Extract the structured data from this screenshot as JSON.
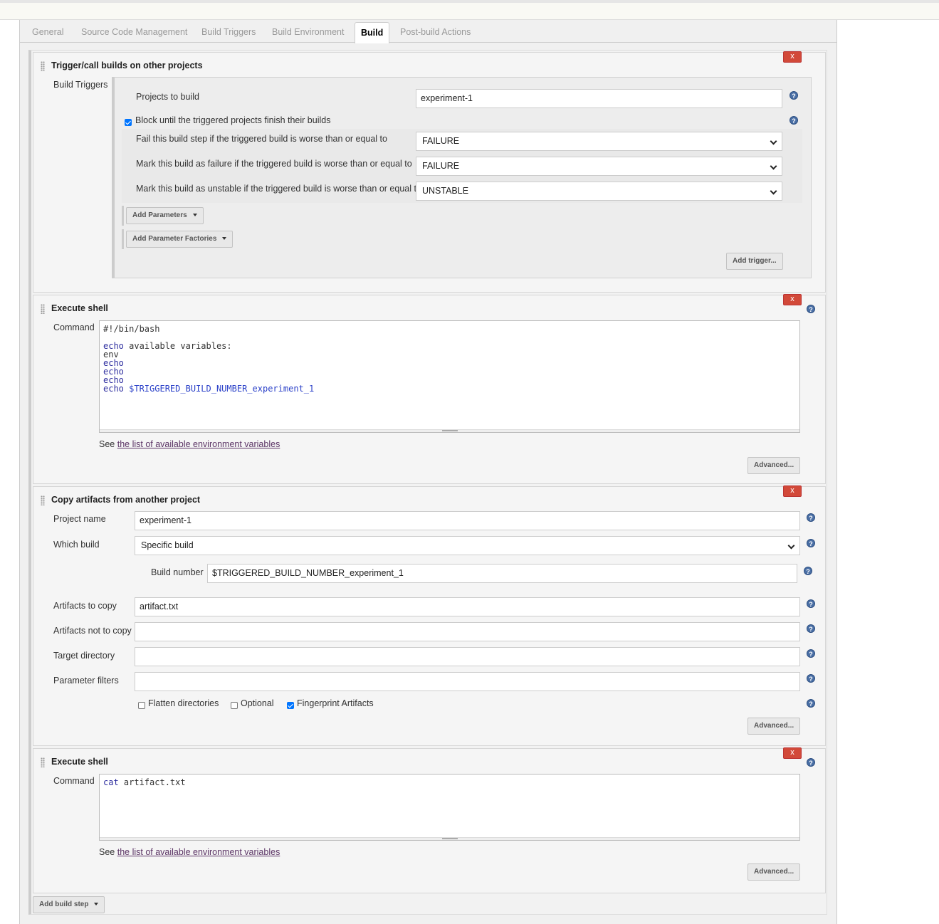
{
  "tabs": [
    {
      "label": "General"
    },
    {
      "label": "Source Code Management"
    },
    {
      "label": "Build Triggers"
    },
    {
      "label": "Build Environment"
    },
    {
      "label": "Build"
    },
    {
      "label": "Post-build Actions"
    }
  ],
  "trigger_block": {
    "title": "Trigger/call builds on other projects",
    "delete_label": "x",
    "build_triggers_label": "Build Triggers",
    "projects_label": "Projects to build",
    "projects_value": "experiment-1",
    "block_label": "Block until the triggered projects finish their builds",
    "block_checked": true,
    "fail_step_label": "Fail this build step if the triggered build is worse than or equal to",
    "fail_step_value": "FAILURE",
    "mark_failure_label": "Mark this build as failure if the triggered build is worse than or equal to",
    "mark_failure_value": "FAILURE",
    "mark_unstable_label": "Mark this build as unstable if the triggered build is worse than or equal to",
    "mark_unstable_value": "UNSTABLE",
    "add_parameters": "Add Parameters",
    "add_parameter_factories": "Add Parameter Factories",
    "add_trigger": "Add trigger..."
  },
  "shell1": {
    "title": "Execute shell",
    "delete_label": "x",
    "command_label": "Command",
    "lines": {
      "l1": "#!/bin/bash",
      "l3_kw": "echo",
      "l3_rest": " available variables:",
      "l4": "env",
      "l5": "echo",
      "l6": "echo",
      "l7": "echo",
      "l8_kw": "echo",
      "l8_var": " $TRIGGERED_BUILD_NUMBER_experiment_1"
    },
    "see_prefix": "See ",
    "see_link": "the list of available environment variables",
    "advanced": "Advanced..."
  },
  "copy_block": {
    "title": "Copy artifacts from another project",
    "delete_label": "x",
    "project_name_label": "Project name",
    "project_name_value": "experiment-1",
    "which_build_label": "Which build",
    "which_build_value": "Specific build",
    "build_number_label": "Build number",
    "build_number_value": "$TRIGGERED_BUILD_NUMBER_experiment_1",
    "artifacts_label": "Artifacts to copy",
    "artifacts_value": "artifact.txt",
    "not_copy_label": "Artifacts not to copy",
    "not_copy_value": "",
    "target_dir_label": "Target directory",
    "target_dir_value": "",
    "param_filters_label": "Parameter filters",
    "param_filters_value": "",
    "flatten_label": "Flatten directories",
    "flatten_checked": false,
    "optional_label": "Optional",
    "optional_checked": false,
    "fingerprint_label": "Fingerprint Artifacts",
    "fingerprint_checked": true,
    "advanced": "Advanced..."
  },
  "shell2": {
    "title": "Execute shell",
    "delete_label": "x",
    "command_label": "Command",
    "line_kw": "cat",
    "line_rest": " artifact.txt",
    "see_prefix": "See ",
    "see_link": "the list of available environment variables",
    "advanced": "Advanced..."
  },
  "add_build_step": "Add build step",
  "help_glyph": "?"
}
